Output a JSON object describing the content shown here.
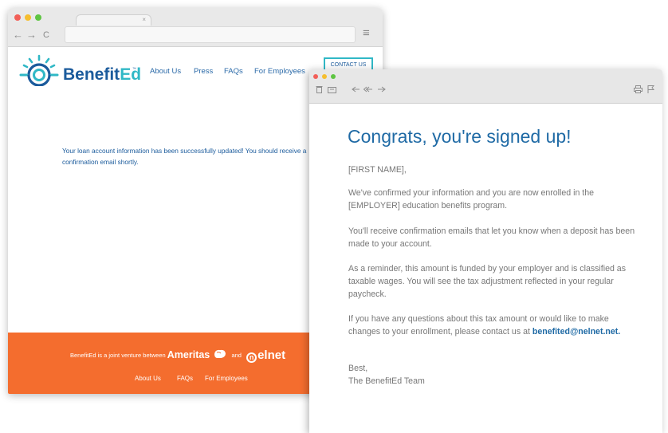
{
  "browser": {
    "nav_back": "←",
    "nav_forward": "→",
    "nav_reload": "C",
    "tab_close": "×",
    "menu_icon": "≡"
  },
  "site": {
    "brand_main": "Benefit",
    "brand_accent": "Ed",
    "brand_tm": "™",
    "nav": [
      "About Us",
      "Press",
      "FAQs",
      "For Employees"
    ],
    "contact_label": "CONTACT US",
    "message": "Your loan account information has been successfully updated! You should receive a confirmation email shortly.",
    "footer": {
      "joint_text": "BenefitEd is a joint venture between",
      "ameritas": "Ameritas",
      "and": "and",
      "nelnet": "elnet",
      "links": [
        "About Us",
        "FAQs",
        "For Employees"
      ]
    },
    "colors": {
      "brand_blue": "#1b5b9c",
      "brand_teal": "#30b8c6",
      "footer_orange": "#f46d2e"
    }
  },
  "email": {
    "toolbar_icons": [
      "trash-icon",
      "archive-icon",
      "reply-icon",
      "reply-all-icon",
      "forward-icon",
      "print-icon",
      "flag-icon"
    ],
    "title": "Congrats, you're signed up!",
    "greeting": "[FIRST NAME],",
    "p1": "We've confirmed your information and you are now enrolled in the [EMPLOYER] education benefits program.",
    "p2": "You'll receive confirmation emails that let you know when a deposit has been made to your account.",
    "p3": "As a reminder, this amount is funded by your employer and is classified as taxable wages. You will see the tax adjustment reflected in your regular paycheck.",
    "p4": "If you have any questions about this tax amount or would like to make changes to your enrollment, please contact us at",
    "contact_email": "benefited@nelnet.net.",
    "signoff": "Best,",
    "signature": "The BenefitEd Team",
    "colors": {
      "title_blue": "#1f6aa5",
      "body_gray": "#777777"
    }
  }
}
